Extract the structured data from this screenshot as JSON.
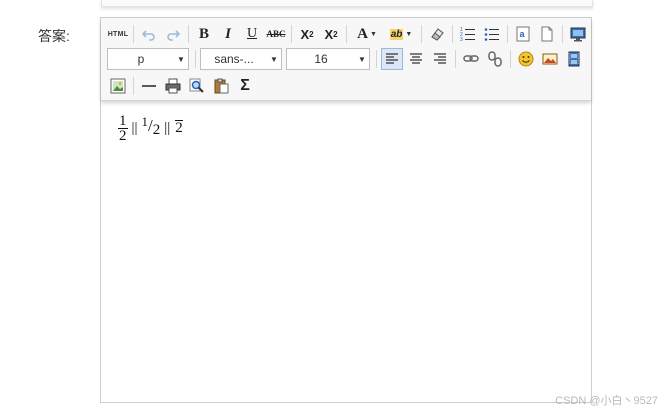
{
  "form": {
    "label": "答案:"
  },
  "toolbar": {
    "html_label": "HTML",
    "bold_label": "B",
    "italic_label": "I",
    "underline_label": "U",
    "strike_label": "ABC",
    "superscript_label": "X",
    "superscript_mark": "2",
    "subscript_label": "X",
    "subscript_mark": "2",
    "font_color_label": "A",
    "highlight_label": "ab",
    "paragraph_select": "p",
    "font_select": "sans-...",
    "size_select": "16",
    "sigma_label": "Σ"
  },
  "content": {
    "frac_num": "1",
    "frac_den": "2",
    "bar1": "||",
    "bevel_num": "1",
    "bevel_slash": "/",
    "bevel_den": "2",
    "bar2": "||",
    "over": "2"
  },
  "watermark": "CSDN @小白丶9527"
}
